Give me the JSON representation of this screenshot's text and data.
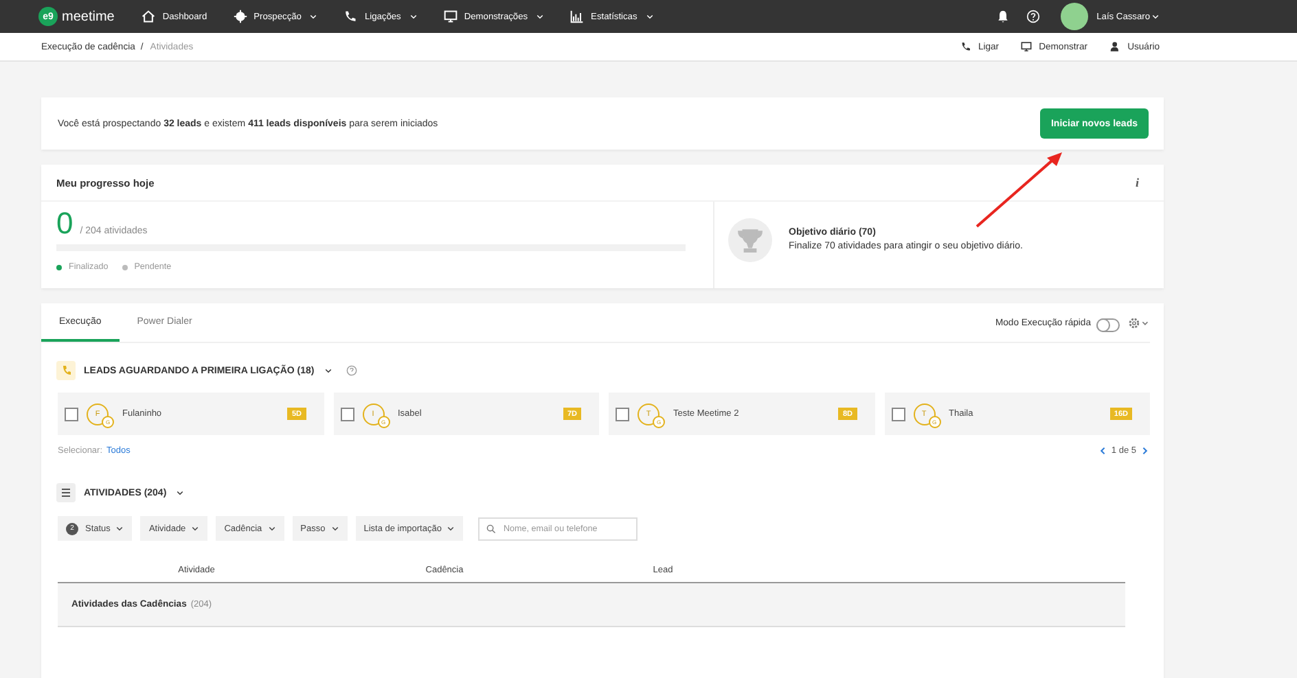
{
  "nav": {
    "logo_mark": "e9",
    "logo": "meetime",
    "items": [
      {
        "label": "Dashboard",
        "kind": "home",
        "dropdown": false
      },
      {
        "label": "Prospecção",
        "kind": "target",
        "dropdown": true
      },
      {
        "label": "Ligações",
        "kind": "phone",
        "dropdown": true
      },
      {
        "label": "Demonstrações",
        "kind": "monitor",
        "dropdown": true
      },
      {
        "label": "Estatísticas",
        "kind": "chart",
        "dropdown": true
      }
    ],
    "user": "Laís Cassaro"
  },
  "breadcrumb": {
    "items": [
      "Execução de cadência",
      "Atividades"
    ],
    "separator": "/",
    "actions": [
      {
        "label": "Ligar",
        "kind": "phone"
      },
      {
        "label": "Demonstrar",
        "kind": "monitor"
      },
      {
        "label": "Usuário",
        "kind": "user"
      }
    ]
  },
  "banner": {
    "text": "Você está prospectando **32 leads** e existem **411 leads disponíveis** para serem iniciados",
    "button": "Iniciar novos leads"
  },
  "progress": {
    "title": "Meu progresso hoje",
    "info": "i",
    "count": "0",
    "total": "/ 204 atividades",
    "level": 0,
    "legend": [
      {
        "label": "Finalizado",
        "color": "#1aa35a"
      },
      {
        "label": "Pendente",
        "color": "#bbbbbb"
      }
    ],
    "goal_title": "Objetivo diário (70)",
    "goal_text": "Finalize 70 atividades para atingir o seu objetivo diário."
  },
  "tabs": [
    {
      "label": "Execução",
      "selected": true
    },
    {
      "label": "Power Dialer",
      "selected": false
    }
  ],
  "quick_mode": {
    "label": "Modo Execução rápida",
    "on": false
  },
  "leads": {
    "title": "LEADS AGUARDANDO A PRIMEIRA LIGAÇÃO (18)",
    "items": [
      {
        "initial": "F",
        "sub": "G",
        "name": "Fulaninho",
        "badge": "5D",
        "checked": false
      },
      {
        "initial": "I",
        "sub": "G",
        "name": "Isabel",
        "badge": "7D",
        "checked": false
      },
      {
        "initial": "T",
        "sub": "G",
        "name": "Teste Meetime 2",
        "badge": "8D",
        "checked": false
      },
      {
        "initial": "T",
        "sub": "G",
        "name": "Thaila",
        "badge": "16D",
        "checked": false
      }
    ],
    "select_label": "Selecionar:",
    "select_link": "Todos",
    "pager": "1 de 5"
  },
  "activities": {
    "title": "ATIVIDADES (204)",
    "filters": [
      {
        "label": "Status",
        "count": "2"
      },
      {
        "label": "Atividade"
      },
      {
        "label": "Cadência"
      },
      {
        "label": "Passo"
      },
      {
        "label": "Lista de importação"
      }
    ],
    "search": {
      "placeholder": "Nome, email ou telefone"
    },
    "columns": [
      "Atividade",
      "Cadência",
      "Lead"
    ],
    "group": {
      "label": "Atividades das Cadências",
      "count": "(204)"
    }
  }
}
